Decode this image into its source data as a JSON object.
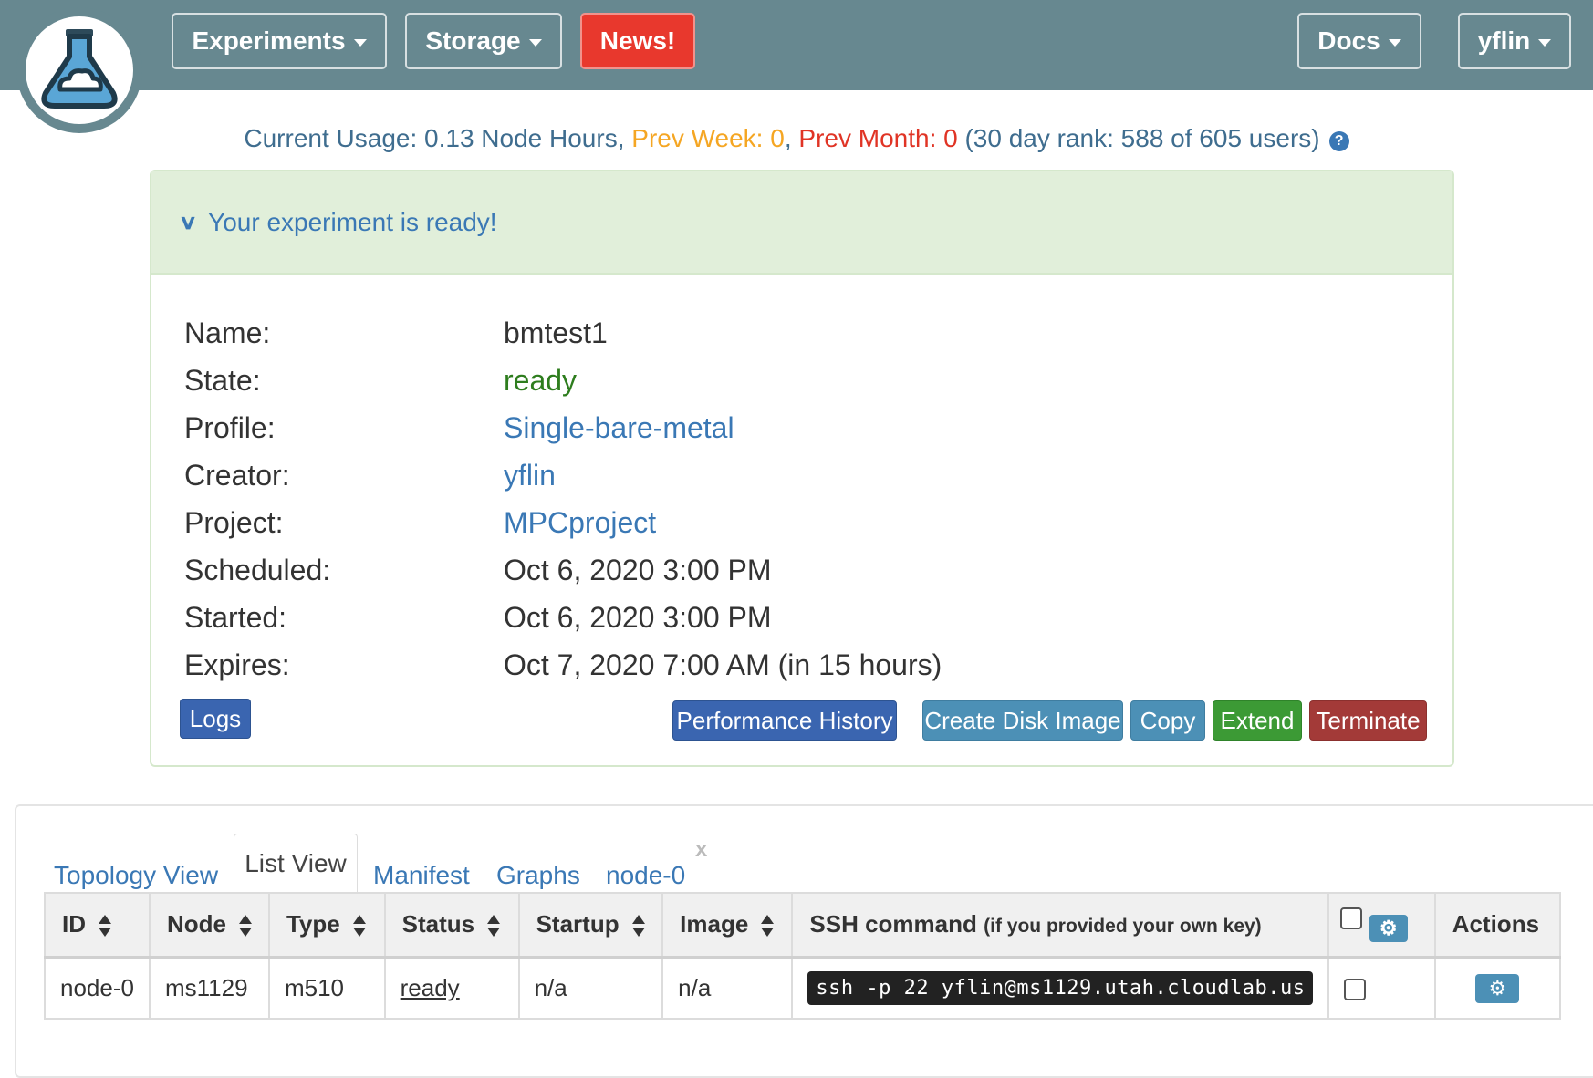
{
  "nav": {
    "experiments": "Experiments",
    "storage": "Storage",
    "news": "News!",
    "docs": "Docs",
    "user": "yflin"
  },
  "usage": {
    "current_label": "Current Usage: ",
    "current_value": "0.13 Node Hours",
    "sep1": ", ",
    "prev_week": "Prev Week: 0",
    "sep2": ", ",
    "prev_month": "Prev Month: 0",
    "rank": " (30 day rank: 588 of 605 users)",
    "help": "?"
  },
  "panel": {
    "chevron": "v",
    "title": "Your experiment is ready!",
    "details": [
      {
        "label": "Name:",
        "value": "bmtest1"
      },
      {
        "label": "State:",
        "value": "ready"
      },
      {
        "label": "Profile:",
        "value": "Single-bare-metal"
      },
      {
        "label": "Creator:",
        "value": "yflin"
      },
      {
        "label": "Project:",
        "value": "MPCproject"
      },
      {
        "label": "Scheduled:",
        "value": "Oct 6, 2020 3:00 PM"
      },
      {
        "label": "Started:",
        "value": "Oct 6, 2020 3:00 PM"
      },
      {
        "label": "Expires:",
        "value": "Oct 7, 2020 7:00 AM (in 15 hours)"
      }
    ],
    "buttons": {
      "logs": "Logs",
      "performance_history": "Performance History",
      "create_disk_image": "Create Disk Image",
      "copy": "Copy",
      "extend": "Extend",
      "terminate": "Terminate"
    }
  },
  "tabs": {
    "topology": "Topology View",
    "list": "List View",
    "manifest": "Manifest",
    "graphs": "Graphs",
    "node0": "node-0",
    "close": "x"
  },
  "table": {
    "headers": {
      "id": "ID",
      "node": "Node",
      "type": "Type",
      "status": "Status",
      "startup": "Startup",
      "image": "Image",
      "ssh": "SSH command",
      "ssh_note": "(if you provided your own key)",
      "actions": "Actions"
    },
    "rows": [
      {
        "id": "node-0",
        "node": "ms1129",
        "type": "m510",
        "status": "ready",
        "startup": "n/a",
        "image": "n/a",
        "ssh": "ssh -p 22 yflin@ms1129.utah.cloudlab.us"
      }
    ]
  },
  "colors": {
    "navbar": "#678890",
    "news": "#e8382d",
    "link": "#3a78b5",
    "ready_green": "#2e7d1e",
    "panel_header": "#e1efda"
  },
  "icons": [
    "flask-logo-icon",
    "caret-down-icon",
    "help-icon",
    "chevron-down-icon",
    "sort-icon",
    "gear-icon",
    "checkbox"
  ]
}
